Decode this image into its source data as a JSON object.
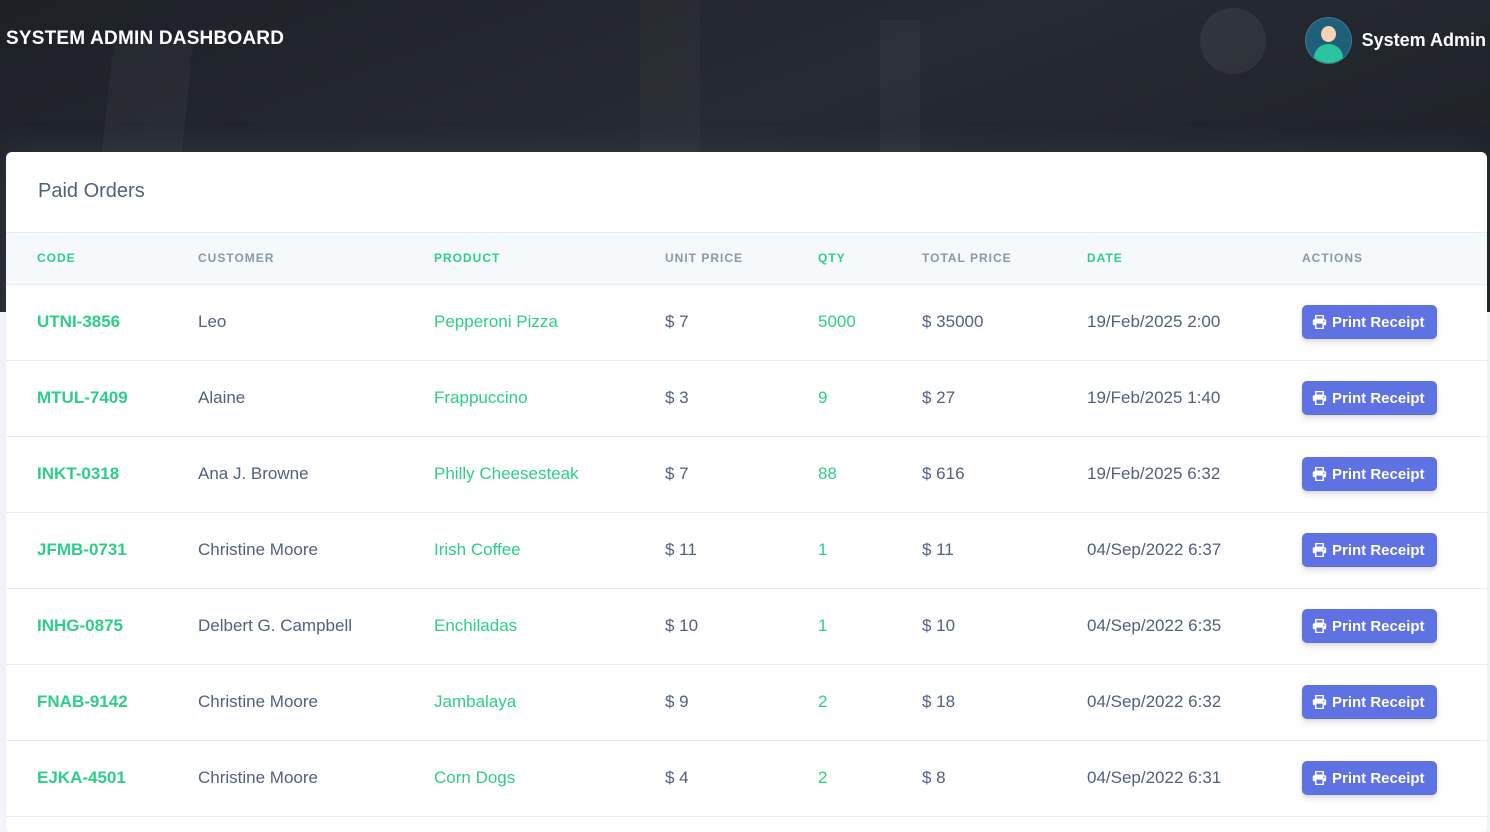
{
  "header": {
    "brand": "SYSTEM ADMIN DASHBOARD",
    "user_name": "System Admin",
    "avatar_icon": "user-avatar-icon"
  },
  "card": {
    "title": "Paid Orders"
  },
  "table": {
    "columns": [
      "CODE",
      "CUSTOMER",
      "PRODUCT",
      "UNIT PRICE",
      "QTY",
      "TOTAL PRICE",
      "DATE",
      "ACTIONS"
    ],
    "action_label": "Print Receipt",
    "action_icon": "printer-icon",
    "rows": [
      {
        "code": "UTNI-3856",
        "customer": "Leo",
        "product": "Pepperoni Pizza",
        "unit_price": "$ 7",
        "qty": "5000",
        "total_price": "$ 35000",
        "date": "19/Feb/2025 2:00"
      },
      {
        "code": "MTUL-7409",
        "customer": "Alaine",
        "product": "Frappuccino",
        "unit_price": "$ 3",
        "qty": "9",
        "total_price": "$ 27",
        "date": "19/Feb/2025 1:40"
      },
      {
        "code": "INKT-0318",
        "customer": "Ana J. Browne",
        "product": "Philly Cheesesteak",
        "unit_price": "$ 7",
        "qty": "88",
        "total_price": "$ 616",
        "date": "19/Feb/2025 6:32"
      },
      {
        "code": "JFMB-0731",
        "customer": "Christine Moore",
        "product": "Irish Coffee",
        "unit_price": "$ 11",
        "qty": "1",
        "total_price": "$ 11",
        "date": "04/Sep/2022 6:37"
      },
      {
        "code": "INHG-0875",
        "customer": "Delbert G. Campbell",
        "product": "Enchiladas",
        "unit_price": "$ 10",
        "qty": "1",
        "total_price": "$ 10",
        "date": "04/Sep/2022 6:35"
      },
      {
        "code": "FNAB-9142",
        "customer": "Christine Moore",
        "product": "Jambalaya",
        "unit_price": "$ 9",
        "qty": "2",
        "total_price": "$ 18",
        "date": "04/Sep/2022 6:32"
      },
      {
        "code": "EJKA-4501",
        "customer": "Christine Moore",
        "product": "Corn Dogs",
        "unit_price": "$ 4",
        "qty": "2",
        "total_price": "$ 8",
        "date": "04/Sep/2022 6:31"
      }
    ]
  },
  "colors": {
    "accent": "#5e72e4",
    "success": "#2dce89",
    "text": "#525f7f",
    "muted": "#8898aa"
  }
}
